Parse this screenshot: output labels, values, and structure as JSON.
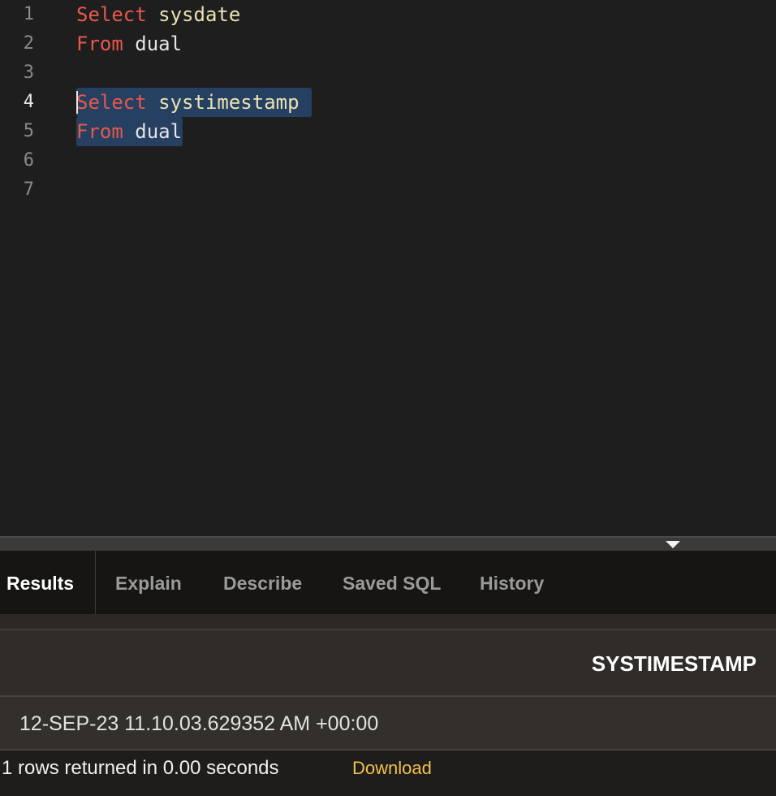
{
  "editor": {
    "lines": [
      {
        "num": "1",
        "kw": "Select",
        "rest": "sysdate"
      },
      {
        "num": "2",
        "kw": "From",
        "rest": "dual"
      },
      {
        "num": "3",
        "kw": "",
        "rest": ""
      },
      {
        "num": "4",
        "kw": "Select",
        "rest": "systimestamp"
      },
      {
        "num": "5",
        "kw": "From",
        "rest": "dual"
      },
      {
        "num": "6",
        "kw": "",
        "rest": ""
      },
      {
        "num": "7",
        "kw": "",
        "rest": ""
      }
    ]
  },
  "splitter": {
    "icon": "chevron-down-icon"
  },
  "tabs": [
    {
      "label": "Results"
    },
    {
      "label": "Explain"
    },
    {
      "label": "Describe"
    },
    {
      "label": "Saved SQL"
    },
    {
      "label": "History"
    }
  ],
  "results": {
    "column": "SYSTIMESTAMP",
    "rows": [
      "12-SEP-23 11.10.03.629352 AM +00:00"
    ],
    "status": "1 rows returned in 0.00 seconds",
    "download": "Download"
  },
  "colors": {
    "keyword": "#e8574e",
    "identifier": "#e9e2b4",
    "selection": "#264061",
    "download_link": "#f0c14b"
  }
}
